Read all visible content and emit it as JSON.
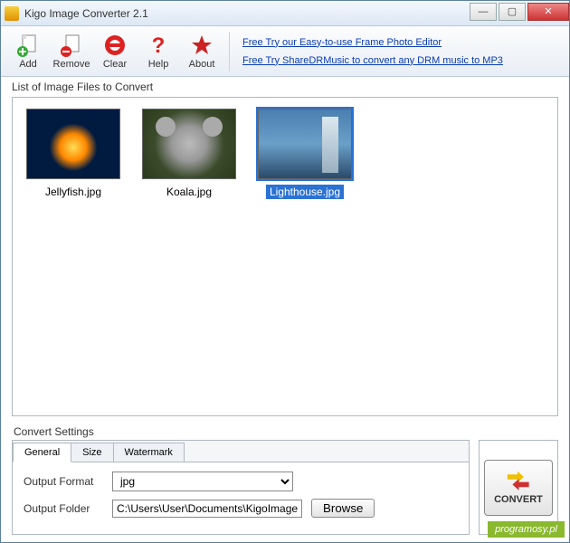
{
  "window": {
    "title": "Kigo Image Converter 2.1"
  },
  "toolbar": {
    "add": "Add",
    "remove": "Remove",
    "clear": "Clear",
    "help": "Help",
    "about": "About"
  },
  "promo": {
    "link1": "Free Try our Easy-to-use Frame Photo Editor",
    "link2": "Free Try ShareDRMusic to convert any DRM music to MP3"
  },
  "filelist": {
    "label": "List of Image Files to Convert",
    "items": [
      {
        "name": "Jellyfish.jpg",
        "selected": false,
        "art": "jelly"
      },
      {
        "name": "Koala.jpg",
        "selected": false,
        "art": "koala"
      },
      {
        "name": "Lighthouse.jpg",
        "selected": true,
        "art": "light"
      }
    ]
  },
  "settings": {
    "label": "Convert Settings",
    "tabs": [
      "General",
      "Size",
      "Watermark"
    ],
    "active_tab": 0,
    "output_format_label": "Output Format",
    "output_format_value": "jpg",
    "output_folder_label": "Output Folder",
    "output_folder_value": "C:\\Users\\User\\Documents\\KigoImageCor",
    "browse": "Browse"
  },
  "convert_label": "CONVERT",
  "footer": "programosy.pl"
}
